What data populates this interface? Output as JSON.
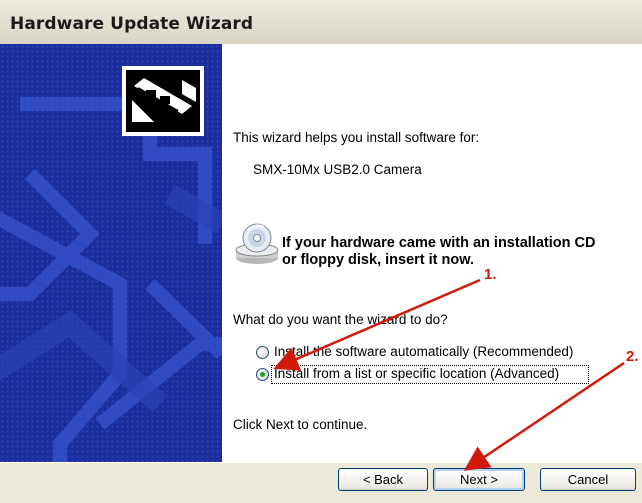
{
  "window": {
    "title": "Hardware Update Wizard"
  },
  "wizard": {
    "intro": "This wizard helps you install software for:",
    "device": "SMX-10Mx USB2.0 Camera",
    "cd_prompt_line1": "If your hardware came with an installation CD",
    "cd_prompt_line2": "or floppy disk, insert it now.",
    "question": "What do you want the wizard to do?",
    "options": [
      {
        "label": "Install the software automatically (Recommended)",
        "selected": false
      },
      {
        "label": "Install from a list or specific location (Advanced)",
        "selected": true
      }
    ],
    "continue_hint": "Click Next to continue."
  },
  "buttons": {
    "back": "< Back",
    "next": "Next >",
    "cancel": "Cancel"
  },
  "annotations": [
    {
      "label": "1."
    },
    {
      "label": "2."
    }
  ],
  "colors": {
    "side_panel": "#1c2e9e",
    "arrow": "#d21a0a"
  },
  "icons": {
    "hardware": "hardware-card-icon",
    "cd": "cd-icon"
  }
}
